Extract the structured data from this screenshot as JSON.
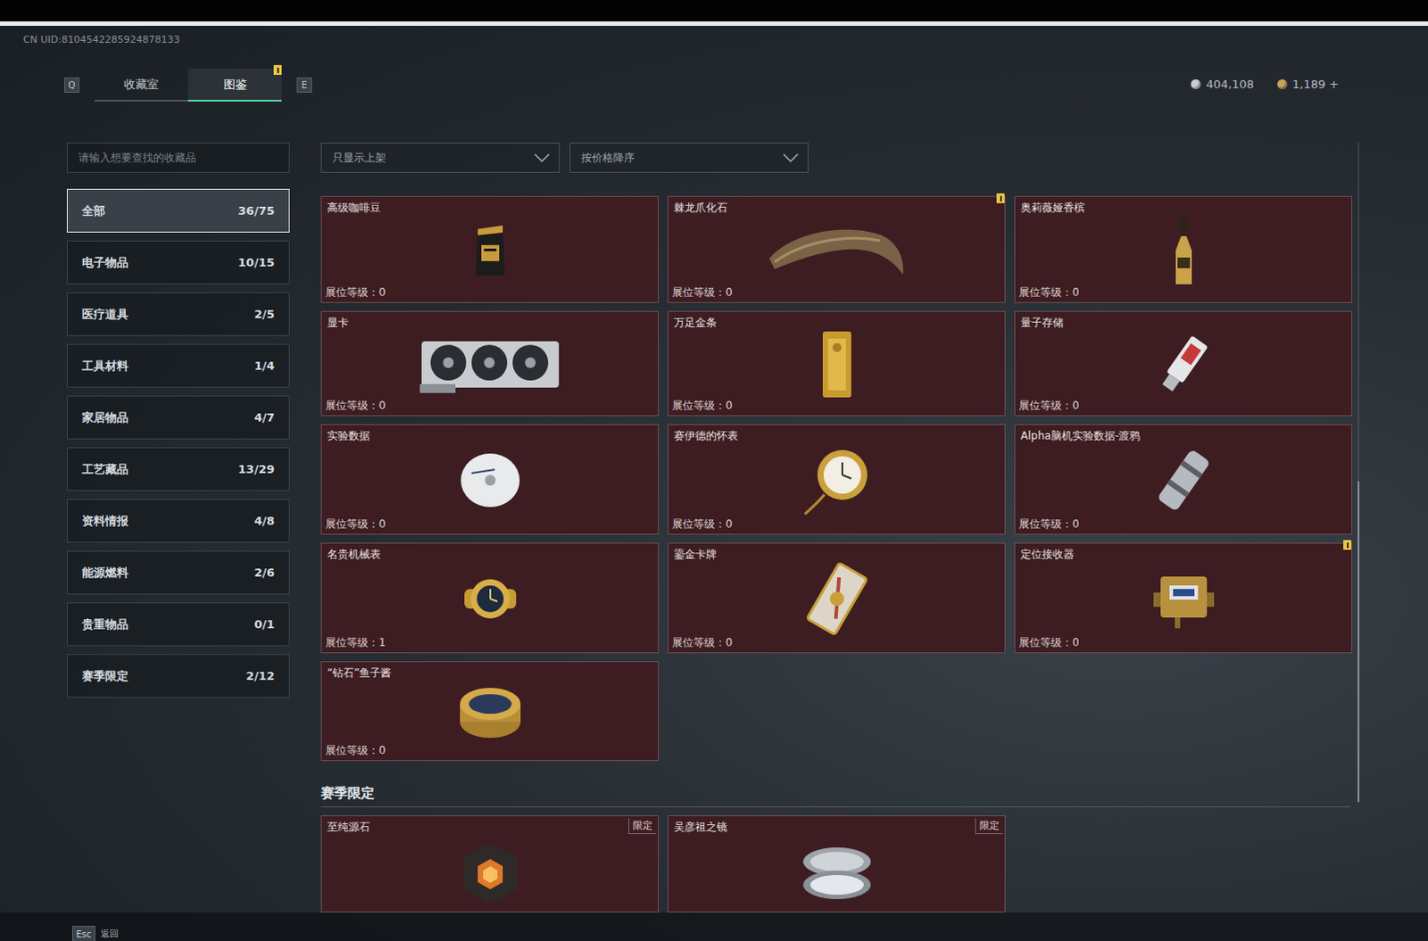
{
  "header": {
    "uid": "CN UID:8104542285924878133",
    "keys": {
      "prev": "Q",
      "next": "E"
    },
    "tabs": [
      {
        "label": "收藏室",
        "selected": false,
        "new": false
      },
      {
        "label": "图鉴",
        "selected": true,
        "new": true
      }
    ]
  },
  "currency": [
    {
      "value": "404,108",
      "color": "#c8ccd0"
    },
    {
      "value": "1,189 +",
      "color": "#c9a25a"
    }
  ],
  "search": {
    "placeholder": "请输入想要查找的收藏品"
  },
  "filters": [
    {
      "label": "只显示上架"
    },
    {
      "label": "按价格降序"
    }
  ],
  "categories": [
    {
      "label": "全部",
      "count": "36/75",
      "selected": true
    },
    {
      "label": "电子物品",
      "count": "10/15",
      "selected": false
    },
    {
      "label": "医疗道具",
      "count": "2/5",
      "selected": false
    },
    {
      "label": "工具材料",
      "count": "1/4",
      "selected": false
    },
    {
      "label": "家居物品",
      "count": "4/7",
      "selected": false
    },
    {
      "label": "工艺藏品",
      "count": "13/29",
      "selected": false
    },
    {
      "label": "资料情报",
      "count": "4/8",
      "selected": false
    },
    {
      "label": "能源燃料",
      "count": "2/6",
      "selected": false
    },
    {
      "label": "贵重物品",
      "count": "0/1",
      "selected": false
    },
    {
      "label": "赛季限定",
      "count": "2/12",
      "selected": false
    }
  ],
  "items": [
    {
      "name": "高级咖啡豆",
      "grade": "展位等级：0",
      "new": false
    },
    {
      "name": "棘龙爪化石",
      "grade": "展位等级：0",
      "new": true
    },
    {
      "name": "奥莉薇娅香槟",
      "grade": "展位等级：0",
      "new": false
    },
    {
      "name": "显卡",
      "grade": "展位等级：0",
      "new": false
    },
    {
      "name": "万足金条",
      "grade": "展位等级：0",
      "new": false
    },
    {
      "name": "量子存储",
      "grade": "展位等级：0",
      "new": false
    },
    {
      "name": "实验数据",
      "grade": "展位等级：0",
      "new": false
    },
    {
      "name": "赛伊德的怀表",
      "grade": "展位等级：0",
      "new": false
    },
    {
      "name": "Alpha脑机实验数据-渡鸦",
      "grade": "展位等级：0",
      "new": false
    },
    {
      "name": "名贵机械表",
      "grade": "展位等级：1",
      "new": false
    },
    {
      "name": "鎏金卡牌",
      "grade": "展位等级：0",
      "new": false
    },
    {
      "name": "定位接收器",
      "grade": "展位等级：0",
      "new": true
    },
    {
      "name": "“钻石”鱼子酱",
      "grade": "展位等级：0",
      "new": false
    }
  ],
  "season": {
    "title": "赛季限定",
    "items": [
      {
        "name": "至纯源石",
        "tag": "限定"
      },
      {
        "name": "吴彦祖之镜",
        "tag": "限定"
      }
    ]
  },
  "footer": {
    "key": "Esc",
    "label": "返回"
  }
}
